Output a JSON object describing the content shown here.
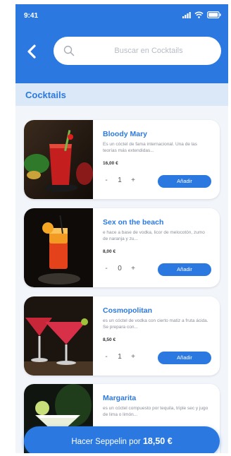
{
  "status": {
    "time": "9:41"
  },
  "search": {
    "placeholder": "Buscar en Cocktails",
    "value": ""
  },
  "section": {
    "title": "Cocktails"
  },
  "items": [
    {
      "name": "Bloody Mary",
      "description": "Es un cóctel de fama internacional. Una de las teorías más extendidas...",
      "price": "16,00 €",
      "quantity": "1",
      "add_label": "Añadir"
    },
    {
      "name": "Sex on the beach",
      "description": "e hace a base de vodka, licor de melocotón, zumo de naranja y zu...",
      "price": "8,00 €",
      "quantity": "0",
      "add_label": "Añadir"
    },
    {
      "name": "Cosmopolitan",
      "description": "es un cóctel de vodka con cierto matiz a fruta ácida. Se prepara con...",
      "price": "8,50 €",
      "quantity": "1",
      "add_label": "Añadir"
    },
    {
      "name": "Margarita",
      "description": "es un cóctel compuesto por tequila, triple sec y jugo de lima o limón...",
      "price": "",
      "quantity": "",
      "add_label": ""
    }
  ],
  "order": {
    "label": "Hacer Seppelin por",
    "total": "18,50 €"
  },
  "colors": {
    "primary": "#2b79e0",
    "header_bg": "#dbe8f8",
    "screen_bg": "#f2f6fb"
  }
}
